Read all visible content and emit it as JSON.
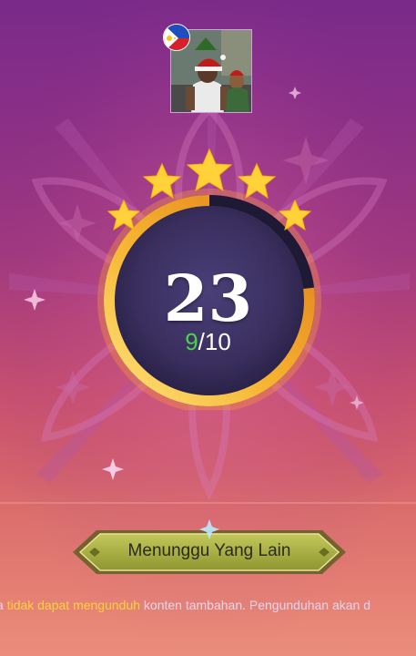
{
  "timer": {
    "seconds": "23",
    "ready": "9",
    "separator": "/",
    "total": "10",
    "remaining_fraction": 0.77
  },
  "player": {
    "avatar": "player-avatar",
    "flag": "philippines-flag"
  },
  "button": {
    "label": "Menunggu Yang Lain"
  },
  "notice": {
    "prefix": "a ",
    "highlight": "tidak dapat mengunduh",
    "suffix": " konten tambahan. Pengunduhan akan d"
  },
  "colors": {
    "ready": "#4dd04a",
    "highlight": "#ffd23a",
    "ring_gold": "#f5b330",
    "button_olive": "#9aa13a"
  }
}
